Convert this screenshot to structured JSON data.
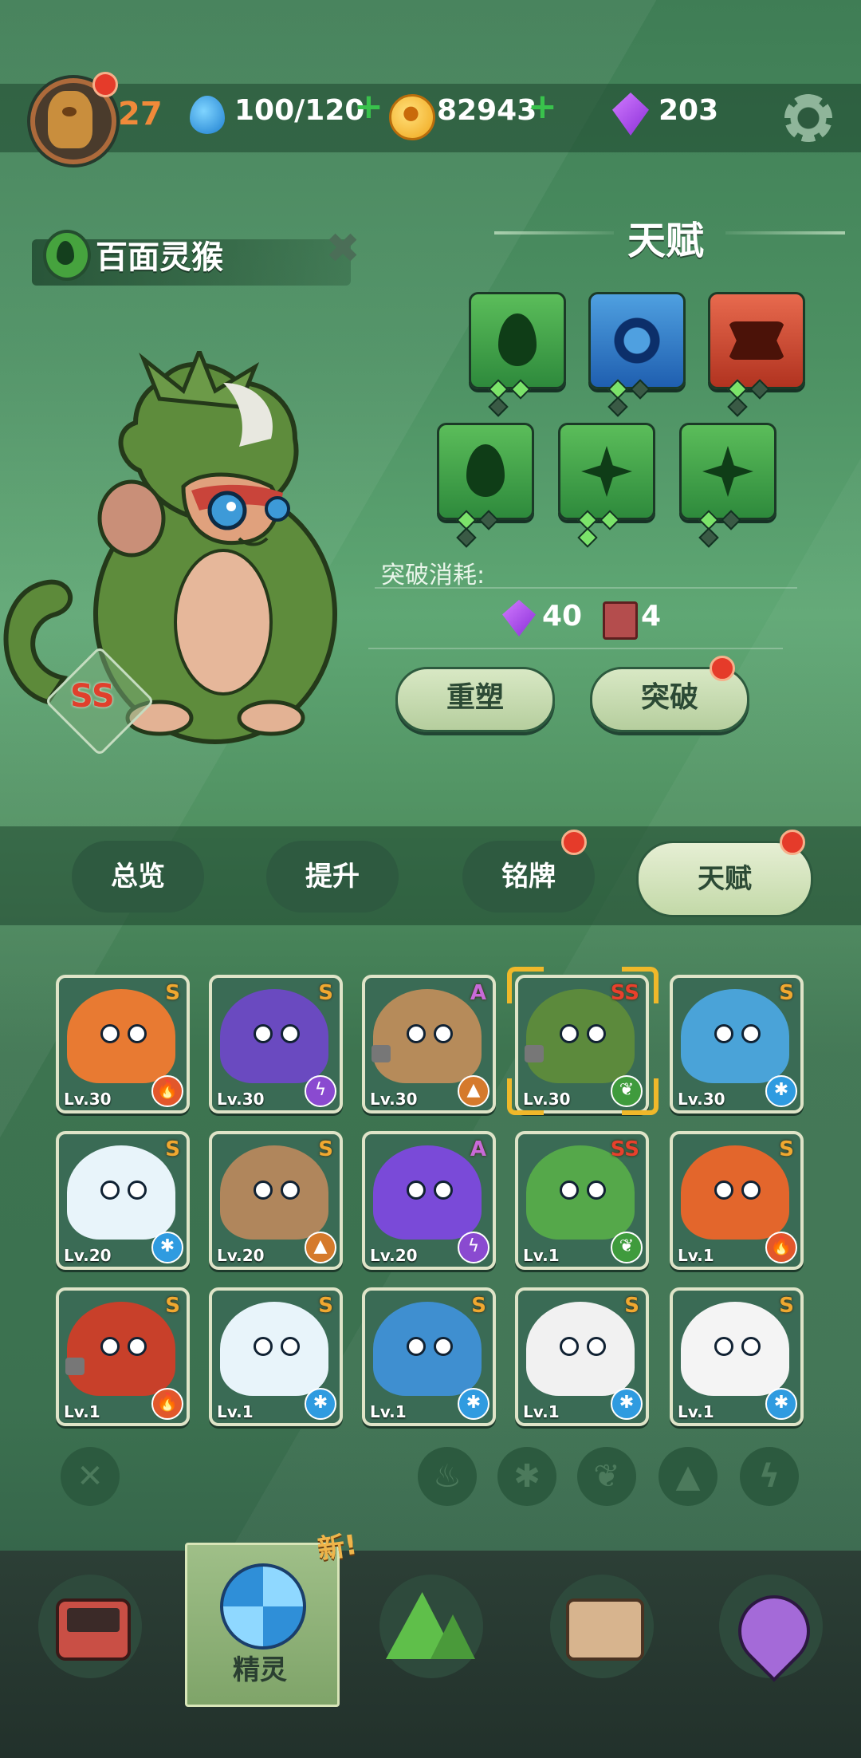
{
  "header": {
    "level": "27",
    "water": "100/120",
    "coins": "82943",
    "gems": "203"
  },
  "spirit": {
    "name": "百面灵猴",
    "rank": "SS"
  },
  "talent": {
    "title": "天赋",
    "cost_label": "突破消耗:",
    "cost_gem": "40",
    "cost_book": "4",
    "reshape_label": "重塑",
    "breakthrough_label": "突破"
  },
  "tabs": [
    "总览",
    "提升",
    "铭牌",
    "天赋"
  ],
  "cards": [
    {
      "rank": "S",
      "lv": "Lv.30",
      "element": "fire",
      "color": "#e87a32"
    },
    {
      "rank": "S",
      "lv": "Lv.30",
      "element": "elec",
      "color": "#6a4ac0"
    },
    {
      "rank": "A",
      "lv": "Lv.30",
      "element": "earth",
      "color": "#b68b5a"
    },
    {
      "rank": "SS",
      "lv": "Lv.30",
      "element": "leaf",
      "color": "#5c8a3c"
    },
    {
      "rank": "S",
      "lv": "Lv.30",
      "element": "ice",
      "color": "#4aa3d8"
    },
    {
      "rank": "S",
      "lv": "Lv.20",
      "element": "ice",
      "color": "#e8f4fa"
    },
    {
      "rank": "S",
      "lv": "Lv.20",
      "element": "earth",
      "color": "#b0865c"
    },
    {
      "rank": "A",
      "lv": "Lv.20",
      "element": "elec",
      "color": "#7a4ad8"
    },
    {
      "rank": "SS",
      "lv": "Lv.1",
      "element": "leaf",
      "color": "#55a84a"
    },
    {
      "rank": "S",
      "lv": "Lv.1",
      "element": "fire",
      "color": "#e3662c"
    },
    {
      "rank": "S",
      "lv": "Lv.1",
      "element": "fire",
      "color": "#c8402a"
    },
    {
      "rank": "S",
      "lv": "Lv.1",
      "element": "ice",
      "color": "#e8f4fa"
    },
    {
      "rank": "S",
      "lv": "Lv.1",
      "element": "ice",
      "color": "#3f8fd0"
    },
    {
      "rank": "S",
      "lv": "Lv.1",
      "element": "ice",
      "color": "#f1f1f1"
    },
    {
      "rank": "S",
      "lv": "Lv.1",
      "element": "ice",
      "color": "#f4f4f4"
    }
  ],
  "nav": {
    "spirit_label": "精灵",
    "new_tag": "新!"
  }
}
